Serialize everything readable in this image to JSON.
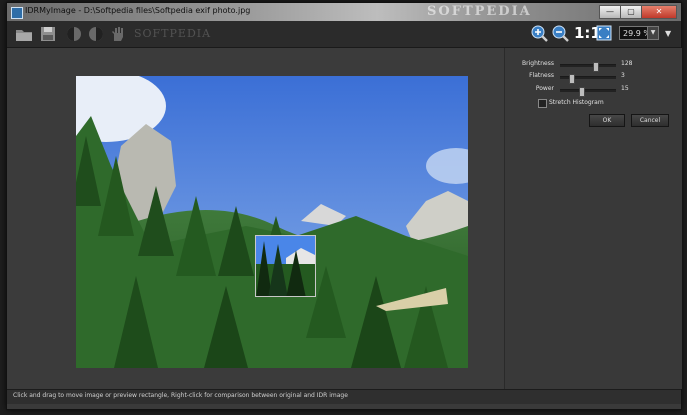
{
  "window": {
    "title": "IDRMyImage - D:\\Softpedia files\\Softpedia exif photo.jpg",
    "watermark": "SOFTPEDIA",
    "buttons": {
      "minimize": "—",
      "maximize": "▢",
      "close": "✕"
    }
  },
  "toolbar": {
    "icons": [
      "open-folder-icon",
      "save-icon",
      "compare-left-icon",
      "compare-right-icon",
      "hand-icon"
    ],
    "watermark": "SOFTPEDIA",
    "zoom_in": "zoom-in-icon",
    "zoom_out": "zoom-out-icon",
    "actual_size_label": "1:1",
    "fit_icon": "fit-to-window-icon",
    "zoom_value": "29.9 %",
    "menu_icon": "dropdown-menu-icon"
  },
  "panel": {
    "sliders": [
      {
        "label": "Brightness",
        "value": "128",
        "position": 0.63
      },
      {
        "label": "Flatness",
        "value": "3",
        "position": 0.2
      },
      {
        "label": "Power",
        "value": "15",
        "position": 0.38
      }
    ],
    "checkbox": {
      "label": "Stretch Histogram",
      "checked": false
    },
    "ok_label": "OK",
    "cancel_label": "Cancel"
  },
  "status": {
    "text": "Click and drag to move image or preview rectangle, Right-click for comparison between original and IDR image"
  },
  "colors": {
    "accent": "#3a7fc4",
    "background": "#3a3a3a",
    "toolbar": "#2b2b2b"
  }
}
